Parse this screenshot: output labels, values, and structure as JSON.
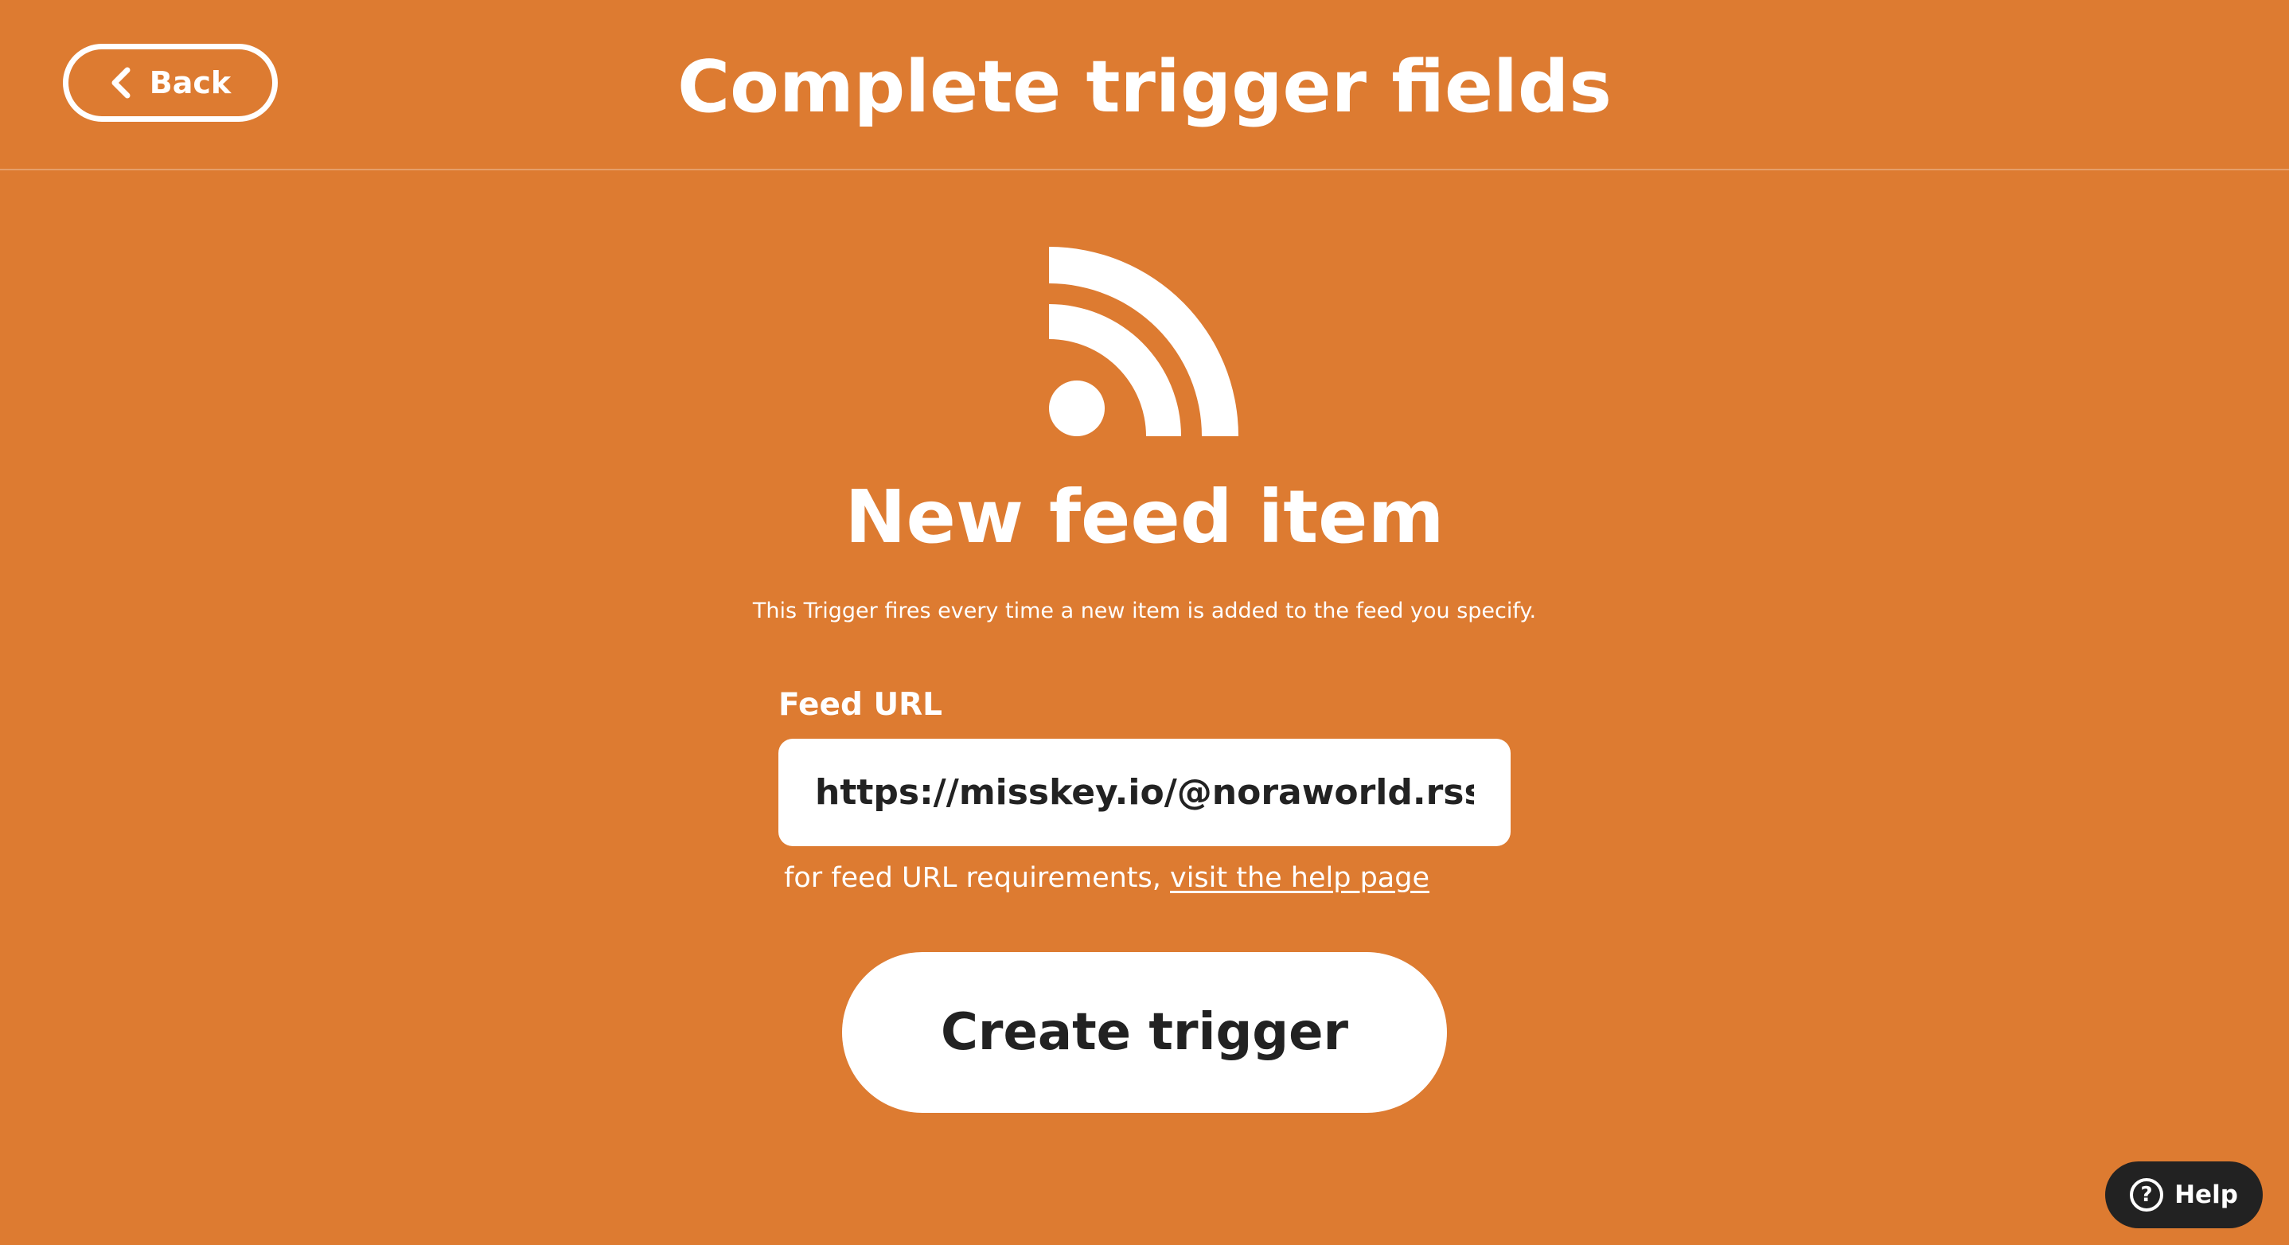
{
  "header": {
    "back_label": "Back",
    "title": "Complete trigger fields"
  },
  "trigger": {
    "icon": "rss-feed-icon",
    "title": "New feed item",
    "description": "This Trigger fires every time a new item is added to the feed you specify."
  },
  "form": {
    "feed_url_label": "Feed URL",
    "feed_url_value": "https://misskey.io/@noraworld.rss",
    "helper_text": "for feed URL requirements, ",
    "helper_link": "visit the help page",
    "submit_label": "Create trigger"
  },
  "help_widget": {
    "icon": "question-circle-icon",
    "icon_glyph": "?",
    "label": "Help"
  },
  "colors": {
    "background": "#dd7b31",
    "foreground": "#ffffff",
    "button_text": "#222222",
    "help_widget_bg": "#222222"
  }
}
